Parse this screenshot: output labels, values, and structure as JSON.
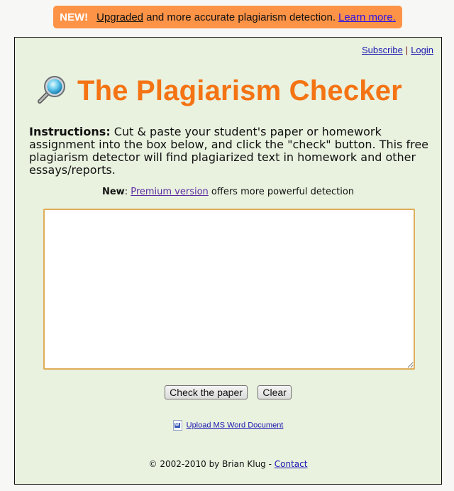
{
  "banner": {
    "badge": "NEW!",
    "upgraded_link": "Upgraded",
    "text": " and more accurate plagiarism detection.",
    "learn_more_link": "Learn more.",
    "color": "#fd9347"
  },
  "top_links": {
    "subscribe": "Subscribe",
    "separator": "|",
    "login": "Login"
  },
  "header": {
    "icon": "magnifier-icon",
    "title": "The Plagiarism Checker",
    "title_color": "#f47313"
  },
  "instructions": {
    "label": "Instructions:",
    "text": " Cut & paste your student's paper or homework assignment into the box below, and click the \"check\" button. This free plagiarism detector will find plagiarized text in homework and other essays/reports."
  },
  "premium": {
    "label": "New",
    "colon": ": ",
    "link": "Premium version",
    "text": " offers more powerful detection"
  },
  "paper_input": {
    "value": "",
    "placeholder": ""
  },
  "buttons": {
    "check": "Check the paper",
    "clear": "Clear"
  },
  "upload": {
    "icon": "word-document-icon",
    "link": "Upload MS Word Document"
  },
  "footer": {
    "copyright": "© 2002-2010 by Brian Klug - ",
    "contact": "Contact"
  }
}
